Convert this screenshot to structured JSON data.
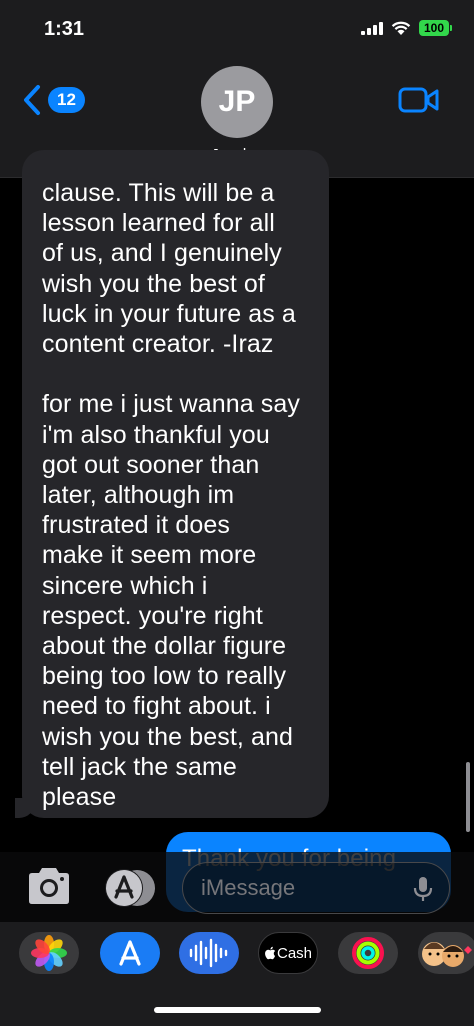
{
  "status_bar": {
    "time": "1:31",
    "battery": "100"
  },
  "header": {
    "back_count": "12",
    "avatar_initials": "JP",
    "contact_name": "Jacob",
    "contact_chevron": ">"
  },
  "incoming_message": {
    "text": "clause. This will be a\nlesson learned for all\nof us, and I genuinely\nwish you the best of\nluck in your future as a\ncontent creator. -Iraz\n\nfor me i just wanna say\ni'm also thankful you\ngot out sooner than\nlater, although im\nfrustrated it does\nmake it seem more\nsincere which i\nrespect. you're right\nabout the dollar figure\nbeing too low to really\nneed to fight about. i\nwish you the best, and\ntell jack the same\nplease"
  },
  "outgoing_message": {
    "text": "Thank you for being"
  },
  "compose": {
    "placeholder": "iMessage"
  },
  "app_strip": {
    "cash_label": "Cash"
  },
  "colors": {
    "accent": "#0a84ff",
    "incoming_bubble": "#26262a",
    "battery": "#32d74b"
  }
}
